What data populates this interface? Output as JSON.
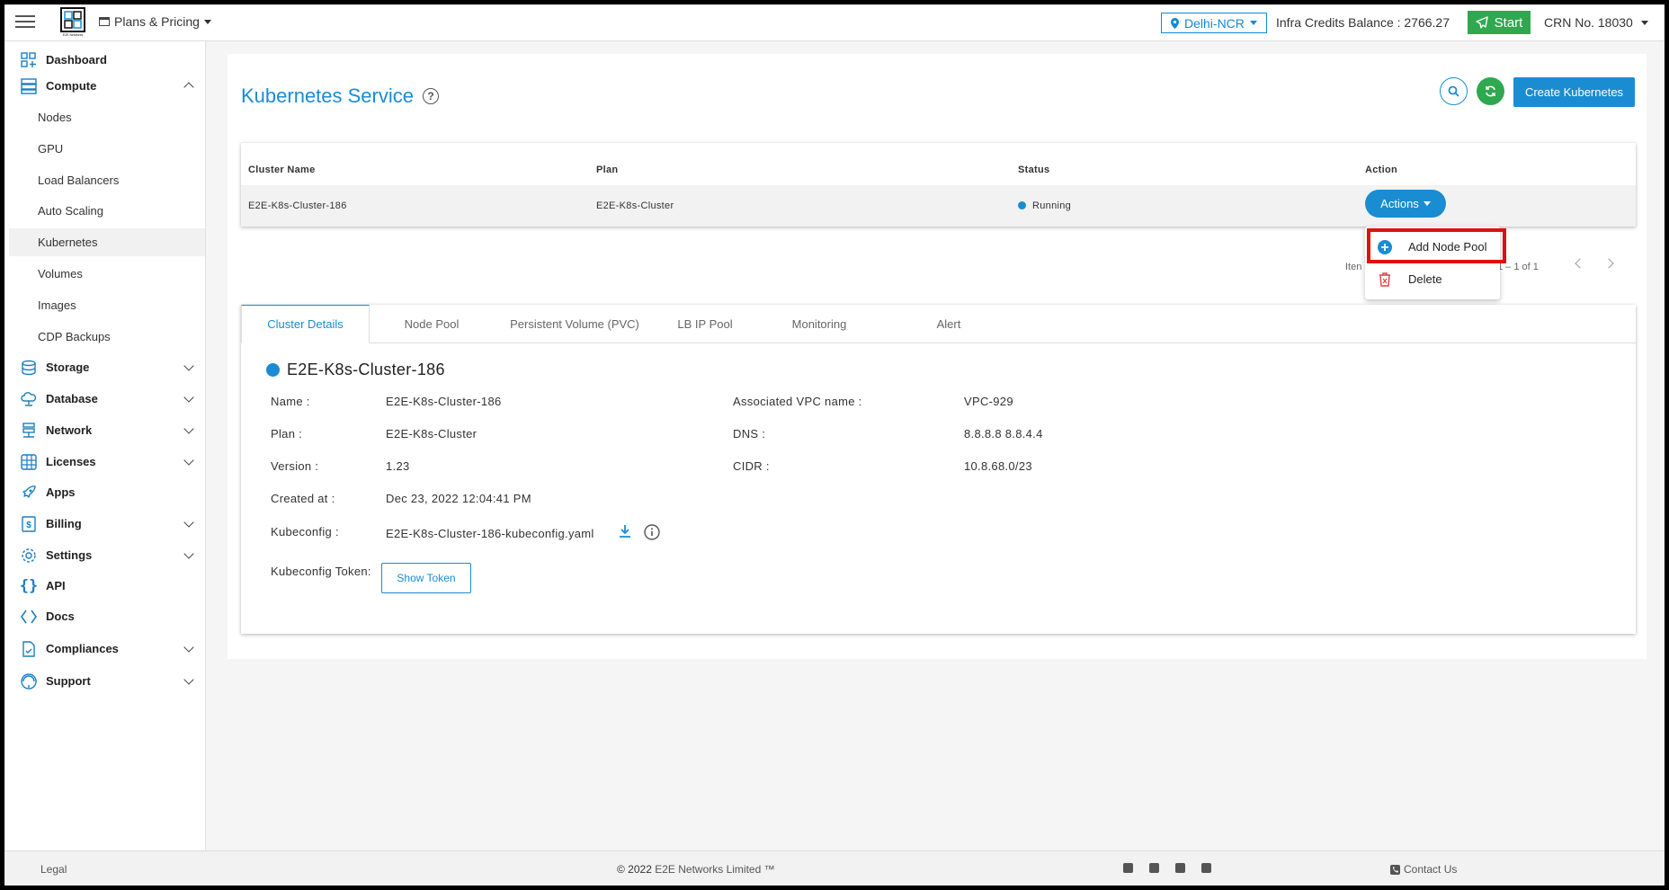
{
  "header": {
    "plans_label": "Plans & Pricing",
    "region": "Delhi-NCR",
    "credits": "Infra Credits Balance : 2766.27",
    "start_label": "Start",
    "crn": "CRN No. 18030",
    "logo_text": "E2E Networks"
  },
  "sidebar": {
    "dashboard": "Dashboard",
    "compute": "Compute",
    "compute_items": [
      "Nodes",
      "GPU",
      "Load Balancers",
      "Auto Scaling",
      "Kubernetes",
      "Volumes",
      "Images",
      "CDP Backups"
    ],
    "storage": "Storage",
    "database": "Database",
    "network": "Network",
    "licenses": "Licenses",
    "apps": "Apps",
    "billing": "Billing",
    "settings": "Settings",
    "api": "API",
    "docs": "Docs",
    "compliances": "Compliances",
    "support": "Support"
  },
  "main": {
    "title": "Kubernetes Service",
    "create_label": "Create Kubernetes",
    "table": {
      "headers": [
        "Cluster Name",
        "Plan",
        "Status",
        "Action"
      ],
      "row": {
        "name": "E2E-K8s-Cluster-186",
        "plan": "E2E-K8s-Cluster",
        "status": "Running",
        "action": "Actions"
      }
    },
    "paginator_left": "Iten",
    "paginator_range": "1 – 1 of 1",
    "dropdown": {
      "add": "Add Node Pool",
      "delete": "Delete"
    },
    "tabs": [
      "Cluster Details",
      "Node Pool",
      "Persistent Volume (PVC)",
      "LB IP Pool",
      "Monitoring",
      "Alert"
    ],
    "details": {
      "title": "E2E-K8s-Cluster-186",
      "name_label": "Name :",
      "name": "E2E-K8s-Cluster-186",
      "plan_label": "Plan :",
      "plan": "E2E-K8s-Cluster",
      "version_label": "Version :",
      "version": "1.23",
      "created_label": "Created at :",
      "created": "Dec 23, 2022 12:04:41 PM",
      "kubeconfig_label": "Kubeconfig :",
      "kubeconfig": "E2E-K8s-Cluster-186-kubeconfig.yaml",
      "token_label": "Kubeconfig Token:",
      "token_btn": "Show Token",
      "vpc_label": "Associated VPC name :",
      "vpc": "VPC-929",
      "dns_label": "DNS :",
      "dns": "8.8.8.8 8.8.4.4",
      "cidr_label": "CIDR :",
      "cidr": "10.8.68.0/23"
    }
  },
  "footer": {
    "legal": "Legal",
    "copyright": "© 2022",
    "company": "E2E Networks Limited ™",
    "contact": "Contact Us"
  },
  "colors": {
    "accent": "#1a8cd2",
    "success": "#2fa84f",
    "danger": "#e01010"
  }
}
